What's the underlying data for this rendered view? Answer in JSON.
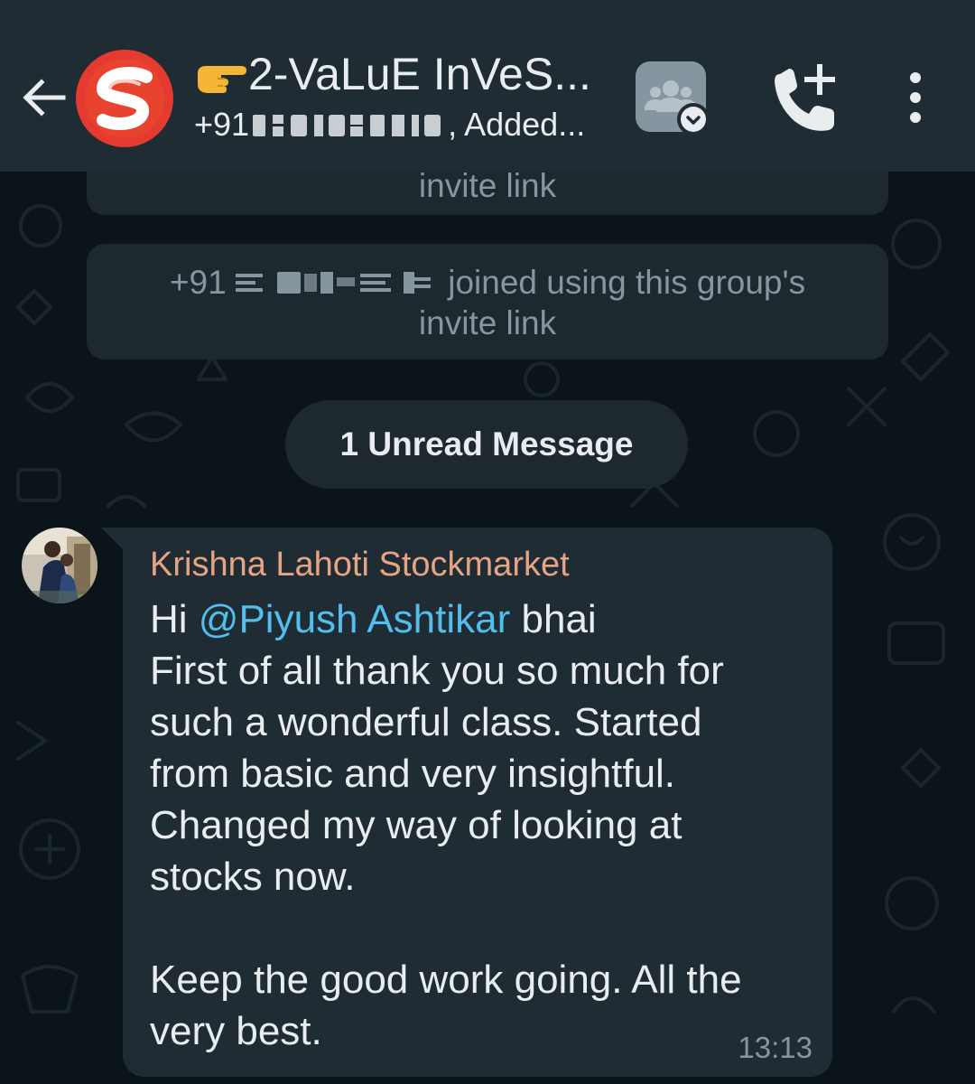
{
  "header": {
    "back_icon": "arrow-left-icon",
    "avatar_letter": "S",
    "title_emoji": "👉",
    "title": "2-VaLuE InVeS...",
    "subtitle_prefix": "+91",
    "subtitle_suffix": ", Added...",
    "community_icon": "community-icon",
    "call_icon": "add-call-icon",
    "menu_icon": "more-vert-icon"
  },
  "system_messages": [
    {
      "text": "invite link"
    },
    {
      "prefix": "+91",
      "text": "joined using this group's invite link"
    }
  ],
  "unread_banner": "1 Unread Message",
  "message": {
    "sender": "Krishna Lahoti Stockmarket",
    "greeting": "Hi",
    "mention": "@Piyush Ashtikar",
    "greeting_suffix": "bhai",
    "lines": [
      "First of all thank you so much for",
      "such a wonderful class. Started",
      "from basic and very insightful.",
      "Changed my way of looking at",
      "stocks now."
    ],
    "closing_lines": [
      "Keep the good work going. All the",
      "very best."
    ],
    "time": "13:13"
  },
  "colors": {
    "header_bg": "#1f2c34",
    "chat_bg": "#0b141a",
    "bubble_bg": "#1f2c34",
    "sender_name": "#e4a584",
    "mention": "#53bdeb",
    "meta_text": "#8696a0",
    "primary_text": "#e9edef"
  }
}
